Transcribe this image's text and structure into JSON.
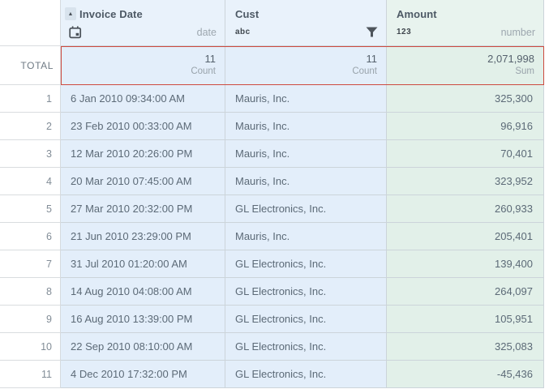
{
  "header": {
    "invoice": {
      "label": "Invoice Date",
      "sort_indicator": "▲",
      "type_label": "date"
    },
    "cust": {
      "label": "Cust",
      "icon_text": "abc"
    },
    "amount": {
      "label": "Amount",
      "icon_text": "123",
      "type_label": "number"
    }
  },
  "total": {
    "row_label": "TOTAL",
    "invoice": {
      "value": "11",
      "agg": "Count"
    },
    "cust": {
      "value": "11",
      "agg": "Count"
    },
    "amount": {
      "value": "2,071,998",
      "agg": "Sum"
    }
  },
  "rows": [
    {
      "n": "1",
      "date": "6 Jan 2010 09:34:00 AM",
      "customer": "Mauris, Inc.",
      "amount": "325,300"
    },
    {
      "n": "2",
      "date": "23 Feb 2010 00:33:00 AM",
      "customer": "Mauris, Inc.",
      "amount": "96,916"
    },
    {
      "n": "3",
      "date": "12 Mar 2010 20:26:00 PM",
      "customer": "Mauris, Inc.",
      "amount": "70,401"
    },
    {
      "n": "4",
      "date": "20 Mar 2010 07:45:00 AM",
      "customer": "Mauris, Inc.",
      "amount": "323,952"
    },
    {
      "n": "5",
      "date": "27 Mar 2010 20:32:00 PM",
      "customer": "GL Electronics, Inc.",
      "amount": "260,933"
    },
    {
      "n": "6",
      "date": "21 Jun 2010 23:29:00 PM",
      "customer": "Mauris, Inc.",
      "amount": "205,401"
    },
    {
      "n": "7",
      "date": "31 Jul 2010 01:20:00 AM",
      "customer": "GL Electronics, Inc.",
      "amount": "139,400"
    },
    {
      "n": "8",
      "date": "14 Aug 2010 04:08:00 AM",
      "customer": "GL Electronics, Inc.",
      "amount": "264,097"
    },
    {
      "n": "9",
      "date": "16 Aug 2010 13:39:00 PM",
      "customer": "GL Electronics, Inc.",
      "amount": "105,951"
    },
    {
      "n": "10",
      "date": "22 Sep 2010 08:10:00 AM",
      "customer": "GL Electronics, Inc.",
      "amount": "325,083"
    },
    {
      "n": "11",
      "date": "4 Dec 2010 17:32:00 PM",
      "customer": "GL Electronics, Inc.",
      "amount": "-45,436"
    }
  ],
  "colors": {
    "highlight_border": "#cd4a3f",
    "date_column_bg": "#e3eefa",
    "amount_column_bg": "#e2f0e9"
  }
}
